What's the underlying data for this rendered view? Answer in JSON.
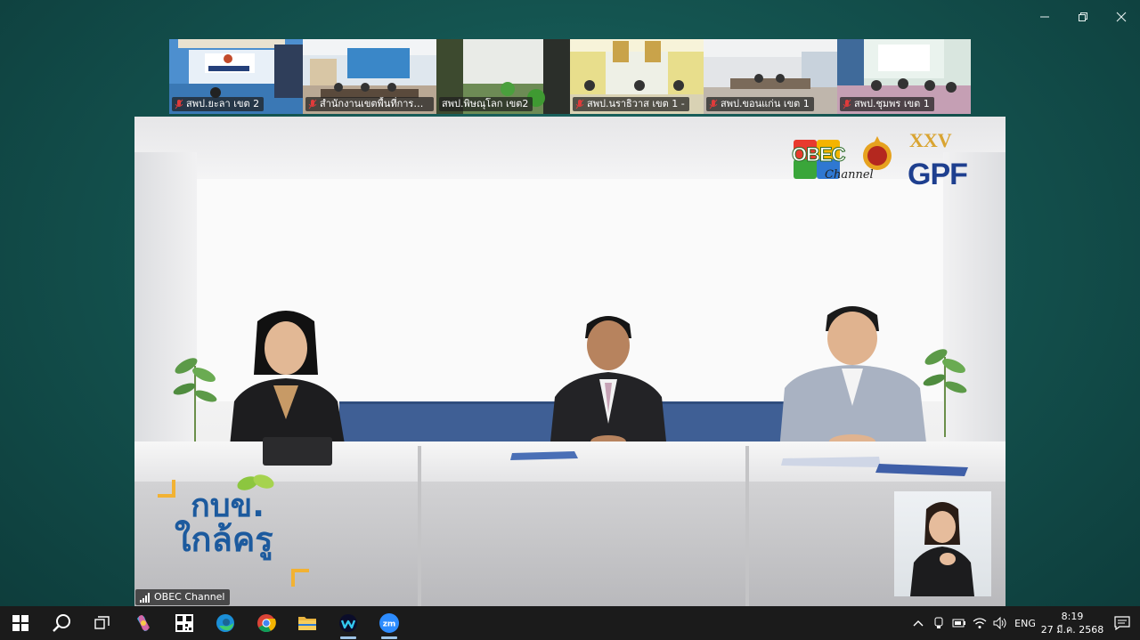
{
  "window": {
    "controls": [
      "minimize-icon",
      "restore-icon",
      "close-icon"
    ]
  },
  "participants": [
    {
      "name": "สพป.ยะลา เขต 2",
      "muted": true
    },
    {
      "name": "สำนักงานเขตพื้นที่การศึก...",
      "muted": true
    },
    {
      "name": "สพป.พิษณุโลก เขต2",
      "muted": false
    },
    {
      "name": "สพป.นราธิวาส เขต 1 -",
      "muted": true
    },
    {
      "name": "สพป.ขอนแก่น เขต 1",
      "muted": true
    },
    {
      "name": "สพป.ชุมพร เขต 1",
      "muted": true
    }
  ],
  "main_video": {
    "channel_label": "OBEC Channel",
    "program_title_line1": "กบข.",
    "program_title_line2": "ใกล้ครู",
    "logos": {
      "obec_word": "OBEC",
      "obec_sub": "Channel",
      "gpf_word": "GPF",
      "gpf_anniversary": "XXV"
    }
  },
  "taskbar": {
    "apps": [
      "windows-start-icon",
      "search-icon",
      "task-view-icon",
      "copilot-icon",
      "qr-app-icon",
      "edge-icon",
      "chrome-icon",
      "file-explorer-icon",
      "webex-icon",
      "zoom-icon"
    ],
    "active_app": "zoom-icon",
    "tray": {
      "language": "ENG",
      "time": "8:19",
      "date": "27 มี.ค. 2568"
    }
  },
  "colors": {
    "desktop": "#145450",
    "taskbar": "#1b1b1b",
    "title_blue": "#1c5a9e"
  }
}
